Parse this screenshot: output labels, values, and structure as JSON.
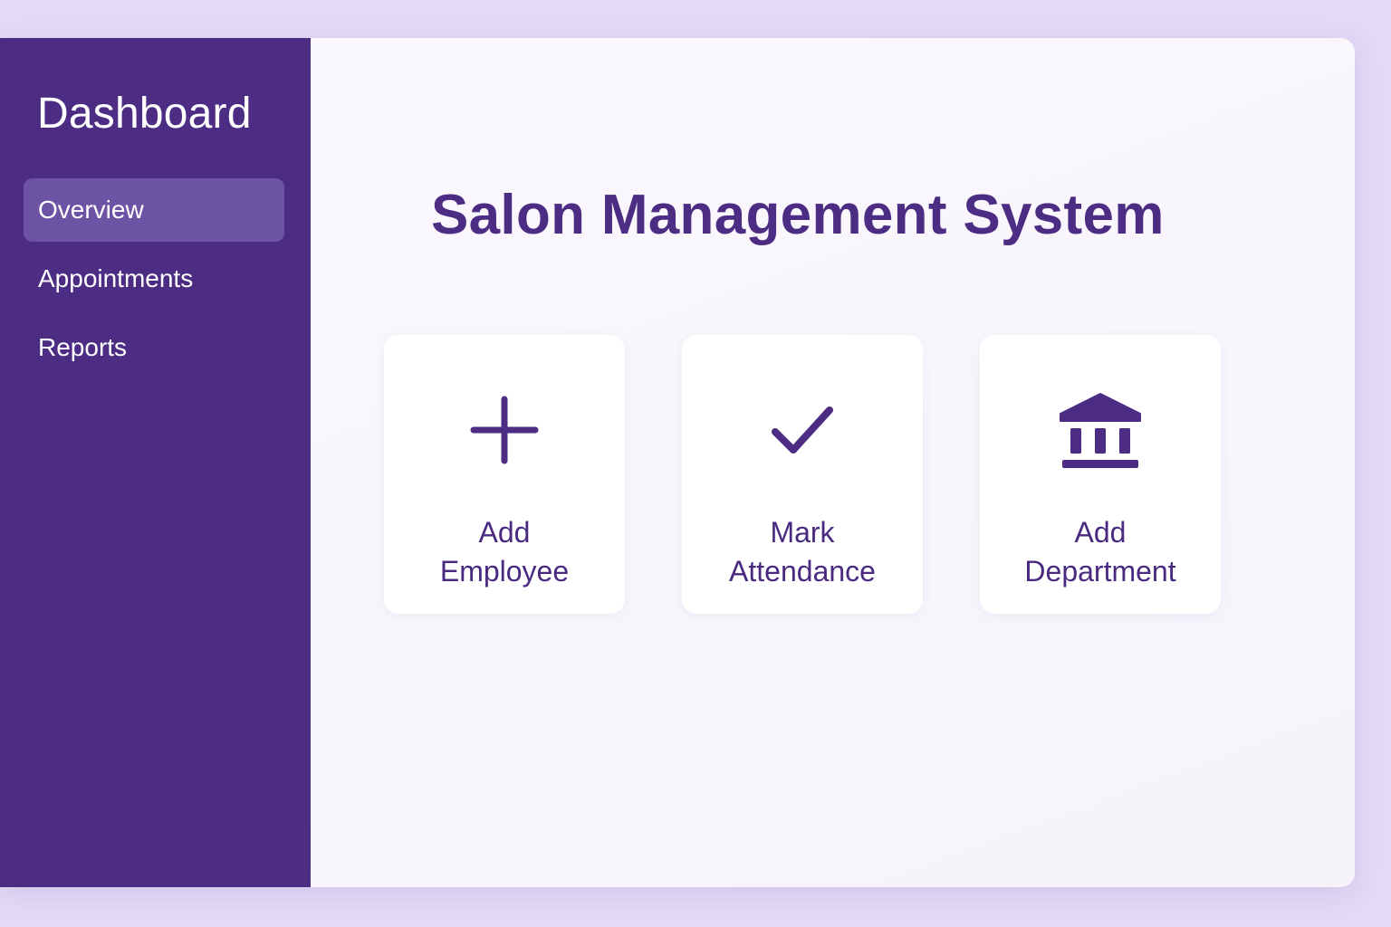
{
  "sidebar": {
    "title": "Dashboard",
    "items": [
      {
        "label": "Overview",
        "active": true
      },
      {
        "label": "Appointments",
        "active": false
      },
      {
        "label": "Reports",
        "active": false
      }
    ]
  },
  "main": {
    "title": "Salon Management System",
    "cards": [
      {
        "icon": "plus-icon",
        "line1": "Add",
        "line2": "Employee"
      },
      {
        "icon": "check-icon",
        "line1": "Mark",
        "line2": "Attendance"
      },
      {
        "icon": "bank-building-icon",
        "line1": "Add",
        "line2": "Department"
      }
    ]
  },
  "colors": {
    "sidebar_bg": "#4d2d84",
    "active_item_bg": "#6c53a4",
    "accent": "#4d2d84",
    "page_bg": "#e3daf6"
  }
}
